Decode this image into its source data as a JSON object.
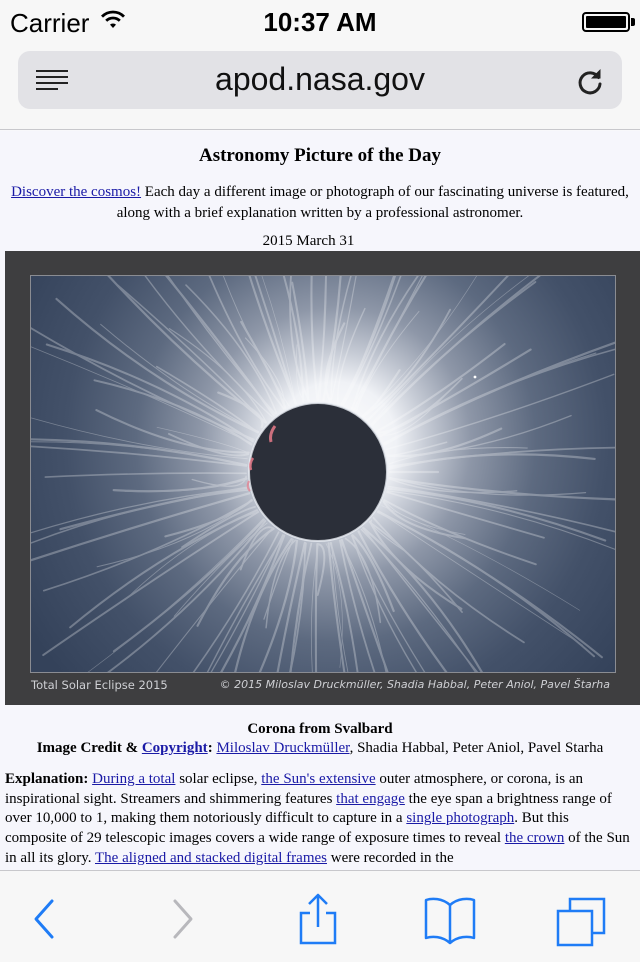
{
  "status_bar": {
    "carrier": "Carrier",
    "time": "10:37 AM",
    "battery_level": 1.0
  },
  "address_bar": {
    "url": "apod.nasa.gov",
    "menu_icon": "reader-menu-icon",
    "reload_icon": "reload-icon"
  },
  "page": {
    "title": "Astronomy Picture of the Day",
    "intro_link": "Discover the cosmos!",
    "intro_text": " Each day a different image or photograph of our fascinating universe is featured, along with a brief explanation written by a professional astronomer.",
    "date": "2015 March 31",
    "image": {
      "caption_left": "Total Solar Eclipse 2015",
      "caption_right": "© 2015 Miloslav Druckmüller, Shadia Habbal, Peter Aniol, Pavel Štarha"
    },
    "image_title": "Corona from Svalbard",
    "credit_label": "Image Credit & ",
    "credit_link": "Copyright",
    "credit_colon": ": ",
    "credit_author_link": "Miloslav Druckmüller",
    "credit_rest": ", Shadia Habbal, Peter Aniol, Pavel Starha",
    "explanation_label": "Explanation: ",
    "explanation_parts": [
      {
        "text": "During a total",
        "link": true
      },
      {
        "text": " solar eclipse, ",
        "link": false
      },
      {
        "text": "the Sun's extensive",
        "link": true
      },
      {
        "text": " outer atmosphere, or corona, is an inspirational sight. Streamers and shimmering features ",
        "link": false
      },
      {
        "text": "that engage",
        "link": true
      },
      {
        "text": " the eye span a brightness range of over 10,000 to 1, making them notoriously difficult to capture in a ",
        "link": false
      },
      {
        "text": "single photograph",
        "link": true
      },
      {
        "text": ". But this composite of 29 telescopic images covers a wide range of exposure times to reveal ",
        "link": false
      },
      {
        "text": "the crown",
        "link": true
      },
      {
        "text": " of the Sun in all its glory. ",
        "link": false
      },
      {
        "text": "The aligned and stacked digital frames",
        "link": true
      },
      {
        "text": " were recorded in the",
        "link": false
      }
    ]
  },
  "toolbar": {
    "back_icon": "back-chevron-icon",
    "forward_icon": "forward-chevron-icon",
    "share_icon": "share-icon",
    "bookmarks_icon": "bookmarks-book-icon",
    "tabs_icon": "tabs-icon"
  },
  "colors": {
    "link": "#1a1aa6",
    "ios_blue": "#1f7cf6",
    "page_bg": "#f6f6fc",
    "photo_frame": "#3e3e40"
  }
}
